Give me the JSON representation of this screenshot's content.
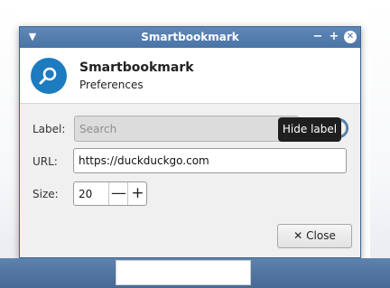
{
  "window": {
    "title": "Smartbookmark",
    "menu_icon": "chevron-down-icon",
    "minimize_label": "−",
    "maximize_label": "+",
    "close_label": "✕"
  },
  "header": {
    "app_name": "Smartbookmark",
    "subtitle": "Preferences",
    "icon": "search-icon",
    "icon_color": "#1d7bbf"
  },
  "form": {
    "label_label": "Label:",
    "label_placeholder": "Search",
    "url_label": "URL:",
    "url_value": "https://duckduckgo.com",
    "size_label": "Size:",
    "size_value": "20",
    "minus": "—",
    "plus": "+",
    "toggle_on": true
  },
  "tooltip": {
    "text": "Hide label"
  },
  "buttons": {
    "close_label": "Close",
    "close_icon": "close-icon"
  },
  "colors": {
    "titlebar": "#4a74a5",
    "accent": "#4a8ac9",
    "panel": "#466a95"
  }
}
